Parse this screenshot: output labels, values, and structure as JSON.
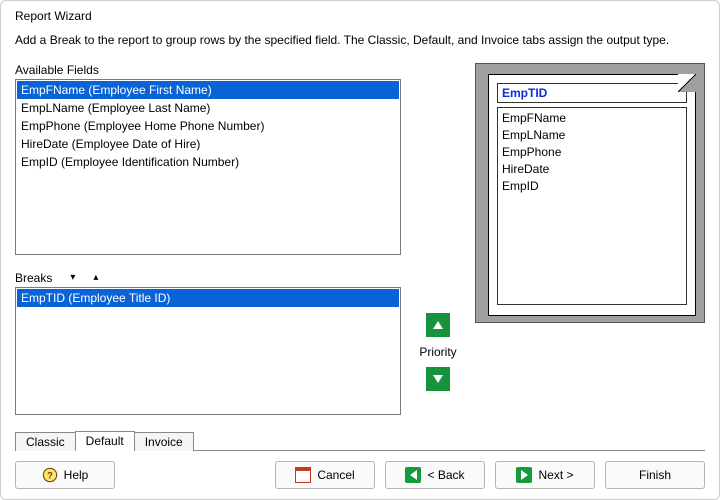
{
  "window": {
    "title": "Report Wizard"
  },
  "description": "Add a Break to the report to group rows by the specified field. The Classic, Default, and Invoice tabs assign the output type.",
  "labels": {
    "available": "Available Fields",
    "breaks": "Breaks",
    "priority": "Priority"
  },
  "available_fields": [
    {
      "code": "EmpFName",
      "desc": "Employee First Name"
    },
    {
      "code": "EmpLName",
      "desc": "Employee Last Name"
    },
    {
      "code": "EmpPhone",
      "desc": "Employee Home Phone Number"
    },
    {
      "code": "HireDate",
      "desc": "Employee Date of Hire"
    },
    {
      "code": "EmpID",
      "desc": "Employee Identification Number"
    }
  ],
  "available_selected_index": 0,
  "breaks_fields": [
    {
      "code": "EmpTID",
      "desc": "Employee Title ID"
    }
  ],
  "breaks_selected_index": 0,
  "preview": {
    "group_field": "EmpTID",
    "body_fields": [
      "EmpFName",
      "EmpLName",
      "EmpPhone",
      "HireDate",
      "EmpID"
    ]
  },
  "tabs": {
    "items": [
      "Classic",
      "Default",
      "Invoice"
    ],
    "active_index": 1
  },
  "footer": {
    "help": "Help",
    "cancel": "Cancel",
    "back": "< Back",
    "next": "Next >",
    "finish": "Finish"
  }
}
